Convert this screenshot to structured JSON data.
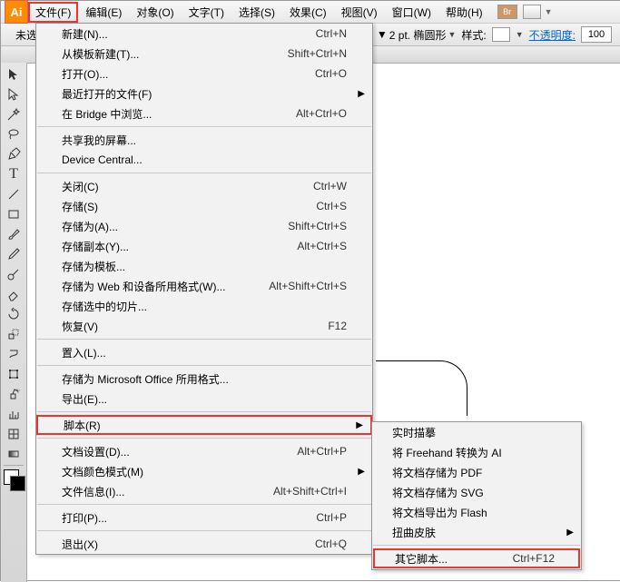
{
  "appIcon": "Ai",
  "menubar": [
    "文件(F)",
    "编辑(E)",
    "对象(O)",
    "文字(T)",
    "选择(S)",
    "效果(C)",
    "视图(V)",
    "窗口(W)",
    "帮助(H)"
  ],
  "menubarBr": "Br",
  "optbar": {
    "label": "未选",
    "stroke": "2 pt. 椭圆形",
    "styleLabel": "样式:",
    "opacityLabel": "不透明度:",
    "opacityValue": "100"
  },
  "fileMenu": [
    {
      "t": "item",
      "label": "新建(N)...",
      "sc": "Ctrl+N"
    },
    {
      "t": "item",
      "label": "从模板新建(T)...",
      "sc": "Shift+Ctrl+N"
    },
    {
      "t": "item",
      "label": "打开(O)...",
      "sc": "Ctrl+O"
    },
    {
      "t": "item",
      "label": "最近打开的文件(F)",
      "sub": true
    },
    {
      "t": "item",
      "label": "在 Bridge 中浏览...",
      "sc": "Alt+Ctrl+O"
    },
    {
      "t": "sep"
    },
    {
      "t": "item",
      "label": "共享我的屏幕..."
    },
    {
      "t": "item",
      "label": "Device Central..."
    },
    {
      "t": "sep"
    },
    {
      "t": "item",
      "label": "关闭(C)",
      "sc": "Ctrl+W"
    },
    {
      "t": "item",
      "label": "存储(S)",
      "sc": "Ctrl+S"
    },
    {
      "t": "item",
      "label": "存储为(A)...",
      "sc": "Shift+Ctrl+S"
    },
    {
      "t": "item",
      "label": "存储副本(Y)...",
      "sc": "Alt+Ctrl+S"
    },
    {
      "t": "item",
      "label": "存储为模板..."
    },
    {
      "t": "item",
      "label": "存储为 Web 和设备所用格式(W)...",
      "sc": "Alt+Shift+Ctrl+S"
    },
    {
      "t": "item",
      "label": "存储选中的切片..."
    },
    {
      "t": "item",
      "label": "恢复(V)",
      "sc": "F12"
    },
    {
      "t": "sep"
    },
    {
      "t": "item",
      "label": "置入(L)..."
    },
    {
      "t": "sep"
    },
    {
      "t": "item",
      "label": "存储为 Microsoft Office 所用格式..."
    },
    {
      "t": "item",
      "label": "导出(E)..."
    },
    {
      "t": "sep"
    },
    {
      "t": "item",
      "label": "脚本(R)",
      "sub": true,
      "hl": true
    },
    {
      "t": "sep"
    },
    {
      "t": "item",
      "label": "文档设置(D)...",
      "sc": "Alt+Ctrl+P"
    },
    {
      "t": "item",
      "label": "文档颜色模式(M)",
      "sub": true
    },
    {
      "t": "item",
      "label": "文件信息(I)...",
      "sc": "Alt+Shift+Ctrl+I"
    },
    {
      "t": "sep"
    },
    {
      "t": "item",
      "label": "打印(P)...",
      "sc": "Ctrl+P"
    },
    {
      "t": "sep"
    },
    {
      "t": "item",
      "label": "退出(X)",
      "sc": "Ctrl+Q"
    }
  ],
  "scriptMenu": [
    {
      "label": "实时描摹"
    },
    {
      "label": "将 Freehand 转换为 AI"
    },
    {
      "label": "将文档存储为 PDF"
    },
    {
      "label": "将文档存储为 SVG"
    },
    {
      "label": "将文档导出为 Flash"
    },
    {
      "label": "扭曲皮肤",
      "sub": true
    },
    {
      "sep": true
    },
    {
      "label": "其它脚本...",
      "sc": "Ctrl+F12",
      "hl": true
    }
  ]
}
